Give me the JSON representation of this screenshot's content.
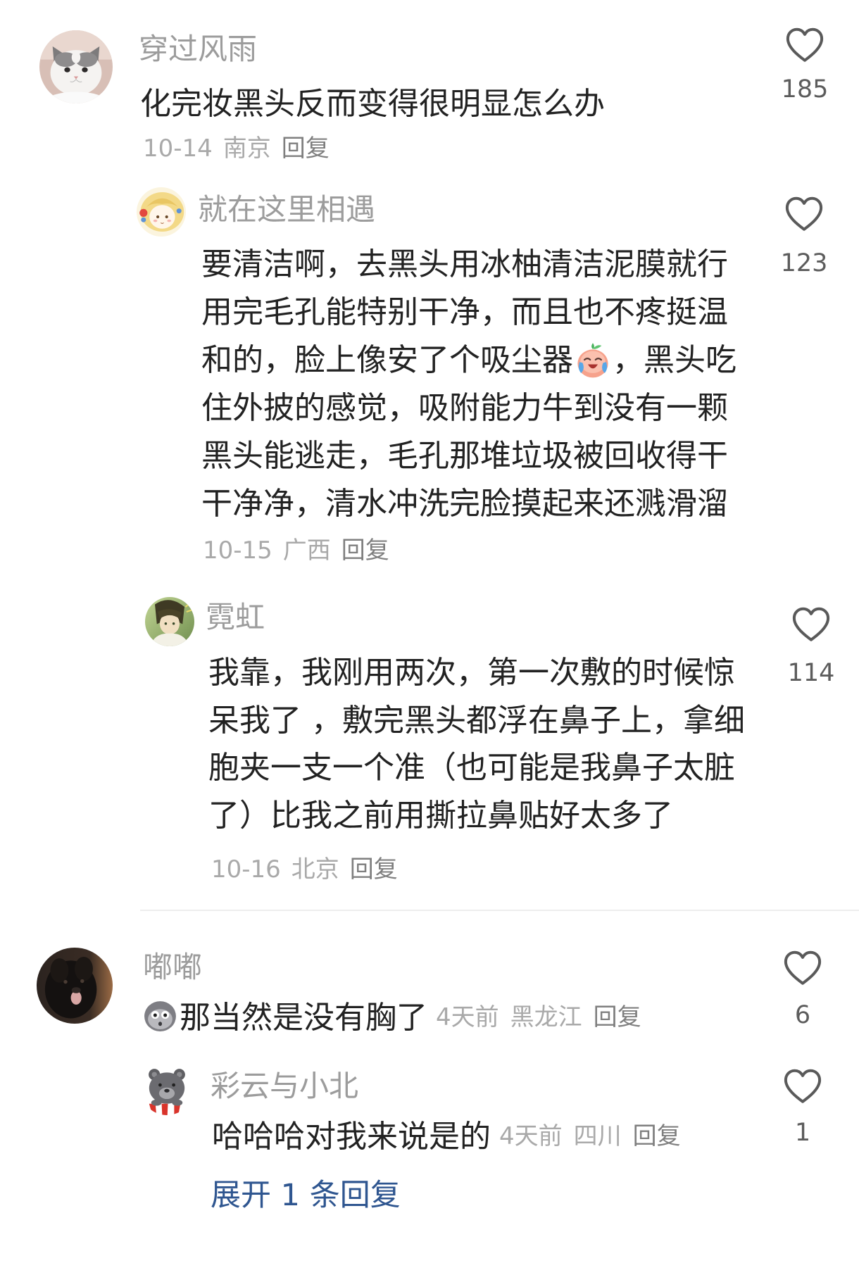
{
  "comments": [
    {
      "avatar_icon": "cat-photo-avatar",
      "username": "穿过风雨",
      "text": "化完妆黑头反而变得很明显怎么办",
      "date": "10-14",
      "location": "南京",
      "reply_label": "回复",
      "likes": "185",
      "replies": [
        {
          "avatar_icon": "anime-girl-avatar",
          "username": "就在这里相遇",
          "lines": [
            "要清洁啊，去黑头用冰柚清洁泥膜就行",
            "用完毛孔能特别干净，而且也不疼挺温",
            [
              "和的，脸上像安了个吸尘器",
              "，黑头吃"
            ],
            "住外披的感觉，吸附能力牛到没有一颗",
            "黑头能逃走，毛孔那堆垃圾被回收得干",
            "干净净，清水冲洗完脸摸起来还溅滑溜"
          ],
          "inline_emoji_icon": "laugh-cry-emoji",
          "date": "10-15",
          "location": "广西",
          "reply_label": "回复",
          "likes": "123"
        },
        {
          "avatar_icon": "anime-illustration-avatar",
          "username": "霓虹",
          "lines": [
            "我靠，我刚用两次，第一次敷的时候惊",
            "呆我了 ，敷完黑头都浮在鼻子上，拿细",
            "胞夹一支一个准（也可能是我鼻子太脏",
            "了）比我之前用撕拉鼻贴好太多了"
          ],
          "date": "10-16",
          "location": "北京",
          "reply_label": "回复",
          "likes": "114"
        }
      ]
    },
    {
      "avatar_icon": "black-dog-photo-avatar",
      "username": "嘟嘟",
      "leading_emoji_icon": "shocked-face-emoji",
      "text": "那当然是没有胸了",
      "date": "4天前",
      "location": "黑龙江",
      "reply_label": "回复",
      "likes": "6",
      "replies": [
        {
          "avatar_icon": "grey-bear-avatar",
          "username": "彩云与小北",
          "text": "哈哈哈对我来说是的",
          "date": "4天前",
          "location": "四川",
          "reply_label": "回复",
          "likes": "1"
        }
      ],
      "expand_replies_label": "展开 1 条回复"
    }
  ],
  "icons": {
    "like": "heart-outline-icon"
  },
  "colors": {
    "username": "#9c9c9c",
    "text": "#222222",
    "meta": "#a9a9a9",
    "reply": "#7f7f7f",
    "link": "#2f5690",
    "icon": "#5a5a5a",
    "divider": "#ededed"
  }
}
